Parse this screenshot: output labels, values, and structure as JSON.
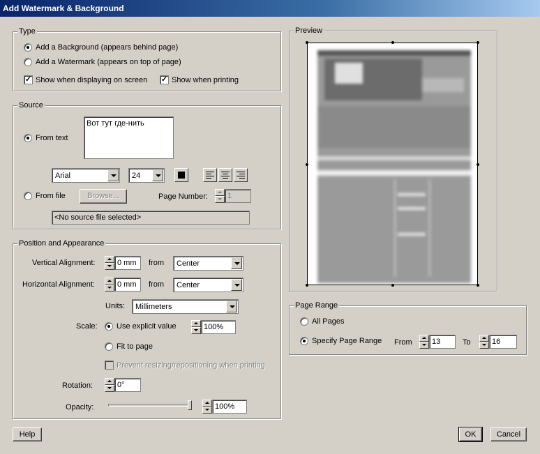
{
  "window": {
    "title": "Add Watermark & Background"
  },
  "type_group": {
    "label": "Type",
    "add_background": "Add a Background (appears behind page)",
    "add_watermark": "Add a Watermark (appears on top of page)",
    "show_on_screen": "Show when displaying on screen",
    "show_when_printing": "Show when printing"
  },
  "source_group": {
    "label": "Source",
    "from_text": "From text",
    "text_value": "Вот тут где-нить",
    "font": "Arial",
    "font_size": "24",
    "from_file": "From file",
    "browse": "Browse...",
    "page_number_label": "Page Number:",
    "page_number_value": "1",
    "file_path": "<No source file selected>"
  },
  "position_group": {
    "label": "Position and Appearance",
    "vertical_label": "Vertical Alignment:",
    "vertical_value": "0 mm",
    "from_label": "from",
    "vertical_from": "Center",
    "horizontal_label": "Horizontal Alignment:",
    "horizontal_value": "0 mm",
    "horizontal_from": "Center",
    "units_label": "Units:",
    "units_value": "Millimeters",
    "scale_label": "Scale:",
    "use_explicit": "Use explicit value",
    "scale_value": "100%",
    "fit_to_page": "Fit to page",
    "prevent_resizing": "Prevent resizing/repositioning when printing",
    "rotation_label": "Rotation:",
    "rotation_value": "0°",
    "opacity_label": "Opacity:",
    "opacity_value": "100%",
    "opacity_level": 1.0
  },
  "preview_group": {
    "label": "Preview"
  },
  "page_range_group": {
    "label": "Page Range",
    "all_pages": "All Pages",
    "specify_range": "Specify Page Range",
    "from_label": "From",
    "from_value": "13",
    "to_label": "To",
    "to_value": "16"
  },
  "buttons": {
    "help": "Help",
    "ok": "OK",
    "cancel": "Cancel"
  },
  "colors": {
    "text_color": "#000000",
    "dialog_bg": "#d4d0c8",
    "title_bar": "#0a246a"
  }
}
